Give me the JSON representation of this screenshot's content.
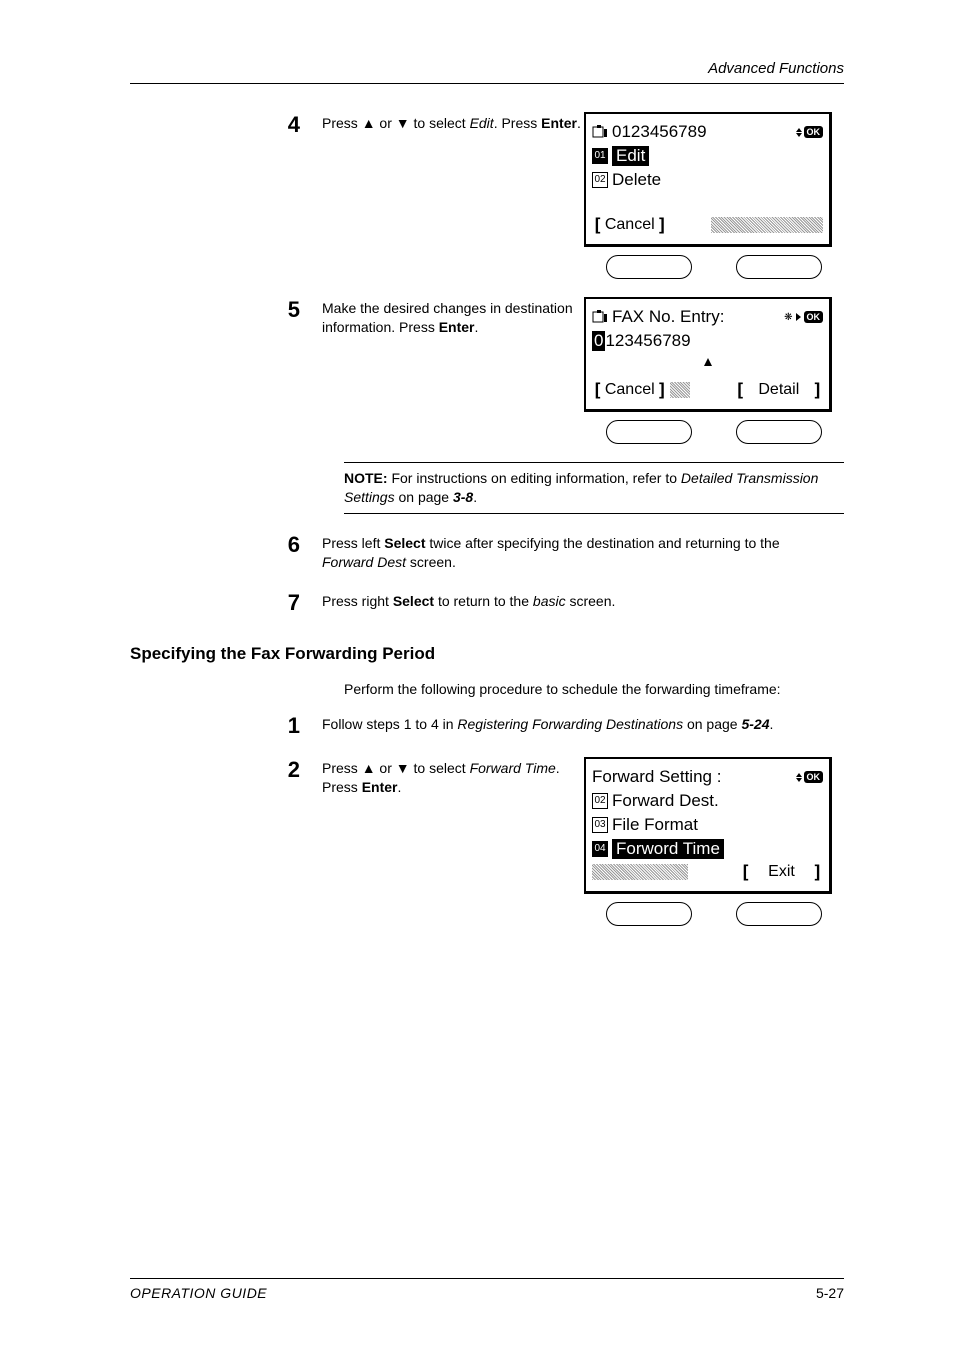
{
  "header": {
    "section": "Advanced Functions"
  },
  "steps": {
    "s4": {
      "num": "4",
      "text_a": "Press ",
      "text_b": " or ",
      "text_c": " to select ",
      "text_d": "Edit",
      "text_e": ". Press ",
      "text_f": "Enter",
      "text_g": "."
    },
    "s5": {
      "num": "5",
      "text_a": "Make the desired changes in destination information. Press ",
      "text_b": "Enter",
      "text_c": "."
    },
    "s6": {
      "num": "6",
      "text_a": "Press left ",
      "text_b": "Select",
      "text_c": " twice after specifying the destination and returning to the ",
      "text_d": "Forward Dest",
      "text_e": " screen."
    },
    "s7": {
      "num": "7",
      "text_a": "Press right ",
      "text_b": "Select",
      "text_c": " to return to the ",
      "text_d": "basic",
      "text_e": " screen."
    },
    "s1b": {
      "num": "1",
      "text_a": "Follow steps 1 to 4 in ",
      "text_b": "Registering Forwarding Destinations",
      "text_c": " on page ",
      "text_d": "5-24",
      "text_e": "."
    },
    "s2b": {
      "num": "2",
      "text_a": "Press ",
      "text_b": " or ",
      "text_c": " to select ",
      "text_d": "Forward Time",
      "text_e": ". Press ",
      "text_f": "Enter",
      "text_g": "."
    }
  },
  "lcd1": {
    "line1": "0123456789",
    "edit_num": "01",
    "edit_label": "Edit",
    "del_num": "02",
    "del_label": "Delete",
    "cancel": "Cancel",
    "ok": "OK"
  },
  "lcd2": {
    "title": "FAX No. Entry",
    "colon": ":",
    "value_first": "0",
    "value_rest": "123456789",
    "cancel": "Cancel",
    "detail": "Detail",
    "ok": "OK"
  },
  "lcd3": {
    "title": "Forward Setting",
    "colon": ":",
    "i1_num": "02",
    "i1": "Forward Dest.",
    "i2_num": "03",
    "i2": "File Format",
    "i3_num": "04",
    "i3": "Forword Time",
    "exit": "Exit",
    "ok": "OK"
  },
  "note": {
    "label": "NOTE:",
    "text_a": " For instructions on editing information, refer to ",
    "text_b": "Detailed Transmission Settings",
    "text_c": " on page ",
    "text_d": "3-8",
    "text_e": "."
  },
  "section": {
    "title": "Specifying the Fax Forwarding Period"
  },
  "intro": {
    "text": "Perform the following procedure to schedule the forwarding timeframe:"
  },
  "footer": {
    "left": "OPERATION GUIDE",
    "right": "5-27"
  }
}
